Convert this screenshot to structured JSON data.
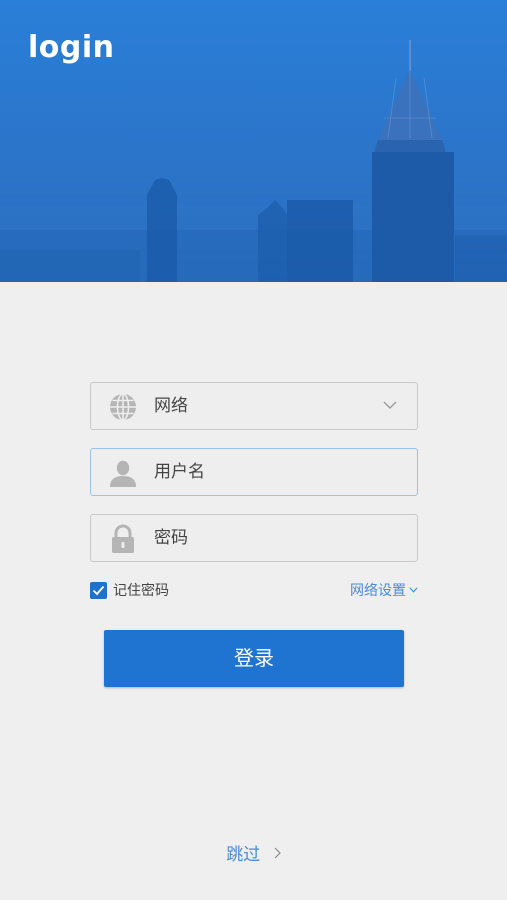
{
  "header": {
    "title": "login"
  },
  "form": {
    "network": {
      "value": "网络",
      "icon": "globe-icon"
    },
    "username": {
      "placeholder": "用户名",
      "icon": "user-icon"
    },
    "password": {
      "placeholder": "密码",
      "icon": "lock-icon"
    },
    "remember": {
      "label": "记住密码",
      "checked": true
    },
    "network_settings": {
      "label": "网络设置"
    },
    "submit_label": "登录"
  },
  "footer": {
    "skip_label": "跳过"
  },
  "colors": {
    "primary": "#1f74d2",
    "link": "#4a8ad6",
    "hero": "#2470c8",
    "background": "#efefef"
  }
}
